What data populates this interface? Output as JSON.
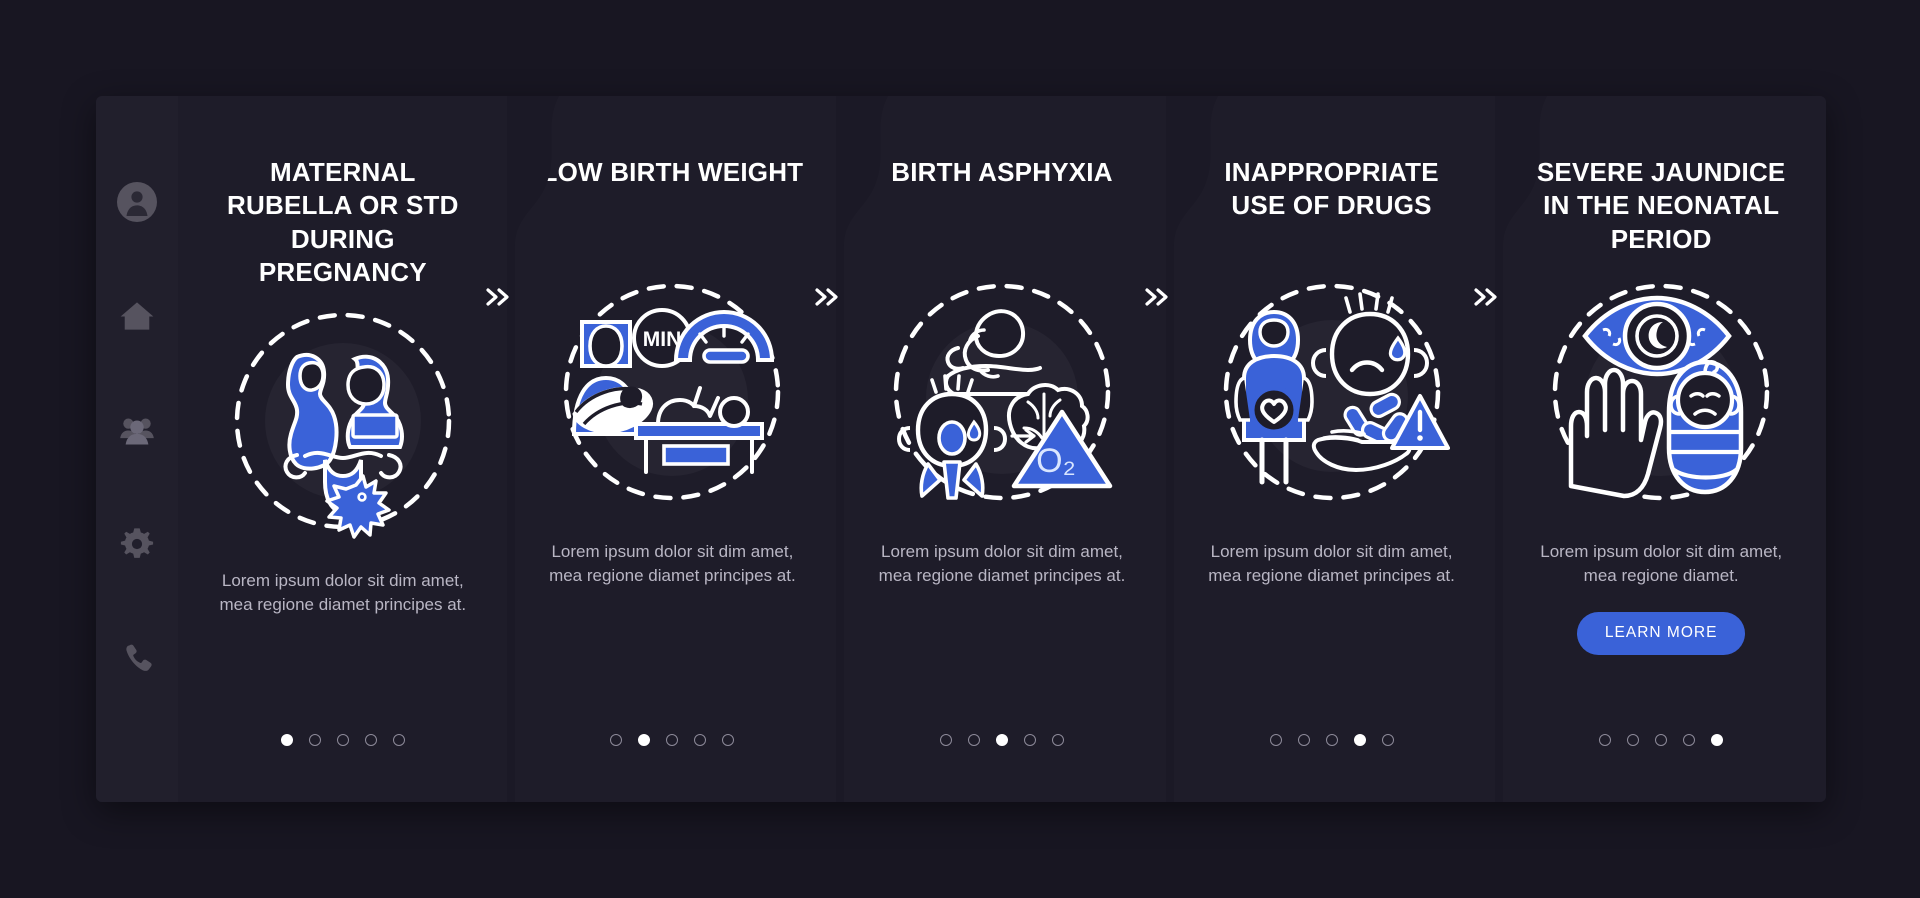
{
  "theme": {
    "page_bg": "#181622",
    "card_bg": "#1b1926",
    "panel_bg": "#1e1c29",
    "sidebar_bg": "#211f2c",
    "accent_blue": "#3a62d8",
    "icon_white": "#ffffff",
    "muted_text": "#b9b6c4",
    "sidebar_icon": "#6b6878"
  },
  "sidebar": {
    "items": [
      {
        "icon": "user-avatar-icon",
        "label": "Profile"
      },
      {
        "icon": "home-icon",
        "label": "Home"
      },
      {
        "icon": "group-people-icon",
        "label": "Community"
      },
      {
        "icon": "gear-icon",
        "label": "Settings"
      },
      {
        "icon": "phone-icon",
        "label": "Contact"
      }
    ]
  },
  "separators": [
    {
      "icon": "double-chevron-right-icon",
      "glyph": "»"
    },
    {
      "icon": "double-chevron-right-icon",
      "glyph": "»"
    },
    {
      "icon": "double-chevron-right-icon",
      "glyph": "»"
    },
    {
      "icon": "double-chevron-right-icon",
      "glyph": "»"
    }
  ],
  "panels": [
    {
      "title": "MATERNAL RUBELLA OR STD DURING PREGNANCY",
      "illustration": "pregnant-woman-uterus-infection-illustration",
      "description": "Lorem ipsum dolor sit dim amet, mea regione diamet principes at.",
      "dots": {
        "count": 5,
        "active": 1
      },
      "cta": null
    },
    {
      "title": "LOW BIRTH WEIGHT",
      "illustration": "nurse-baby-weighing-scale-illustration",
      "illustration_label": "MIN",
      "description": "Lorem ipsum dolor sit dim amet, mea regione diamet principes at.",
      "dots": {
        "count": 5,
        "active": 2
      },
      "cta": null
    },
    {
      "title": "BIRTH ASPHYXIA",
      "illustration": "newborn-crying-baby-brain-oxygen-illustration",
      "illustration_label": "O₂",
      "description": "Lorem ipsum dolor sit dim amet, mea regione diamet principes at.",
      "dots": {
        "count": 5,
        "active": 3
      },
      "cta": null
    },
    {
      "title": "INAPPROPRIATE USE OF DRUGS",
      "illustration": "pregnant-woman-pills-warning-illustration",
      "description": "Lorem ipsum dolor sit dim amet, mea regione diamet principes at.",
      "dots": {
        "count": 5,
        "active": 4
      },
      "cta": null
    },
    {
      "title": "SEVERE JAUNDICE IN THE NEONATAL PERIOD",
      "illustration": "jaundiced-eye-swaddled-baby-illustration",
      "description": "Lorem ipsum dolor sit dim amet, mea regione diamet.",
      "dots": {
        "count": 5,
        "active": 5
      },
      "cta": "LEARN MORE"
    }
  ]
}
